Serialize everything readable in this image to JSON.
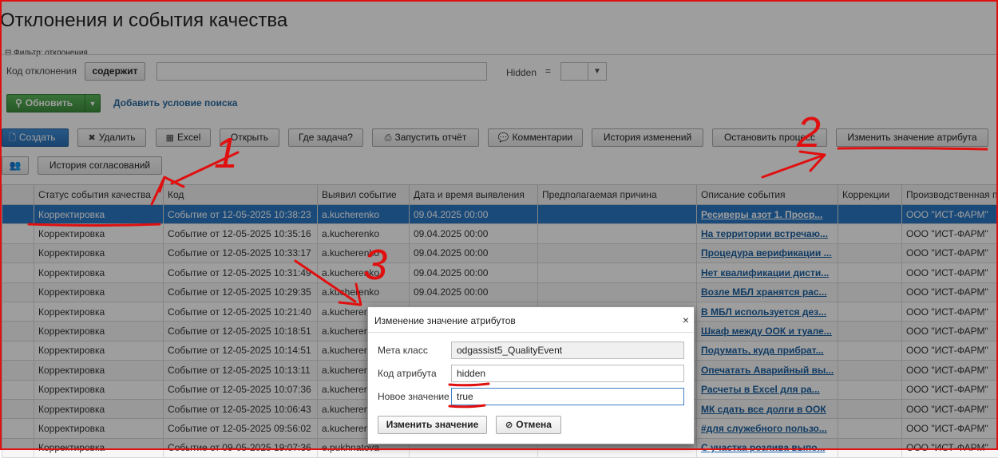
{
  "page": {
    "title": "Отклонения и события качества"
  },
  "filter": {
    "legend": "⊟ Фильтр: отклонения",
    "code_label": "Код отклонения",
    "operator_label": "содержит",
    "code_value": "",
    "hidden_label": "Hidden",
    "eq_sign": "="
  },
  "actions": {
    "refresh_label": "Обновить",
    "add_condition_link": "Добавить условие поиска"
  },
  "toolbar": {
    "create": "Создать",
    "delete": "Удалить",
    "excel": "Excel",
    "open": "Открыть",
    "where_task": "Где задача?",
    "run_report": "Запустить отчёт",
    "comments": "Комментарии",
    "history": "История изменений",
    "stop_process": "Остановить процесс",
    "change_attr": "Изменить значение атрибута",
    "approval_history": "История согласований"
  },
  "table": {
    "headers": [
      "",
      "Статус события качества",
      "Код",
      "Выявил событие",
      "Дата и время выявления",
      "Предполагаемая причина",
      "Описание события",
      "Коррекции",
      "Производственная п"
    ],
    "rows": [
      [
        "",
        "Корректировка",
        "Событие от 12-05-2025 10:38:23",
        "a.kucherenko",
        "09.04.2025 00:00",
        "",
        "Ресиверы азот 1. Проср...",
        "",
        "ООО \"ИСТ-ФАРМ\""
      ],
      [
        "",
        "Корректировка",
        "Событие от 12-05-2025 10:35:16",
        "a.kucherenko",
        "09.04.2025 00:00",
        "",
        "На территории встречаю...",
        "",
        "ООО \"ИСТ-ФАРМ\""
      ],
      [
        "",
        "Корректировка",
        "Событие от 12-05-2025 10:33:17",
        "a.kucherenko",
        "09.04.2025 00:00",
        "",
        "Процедура верификации ...",
        "",
        "ООО \"ИСТ-ФАРМ\""
      ],
      [
        "",
        "Корректировка",
        "Событие от 12-05-2025 10:31:49",
        "a.kucherenko",
        "09.04.2025 00:00",
        "",
        "Нет квалификации дисти...",
        "",
        "ООО \"ИСТ-ФАРМ\""
      ],
      [
        "",
        "Корректировка",
        "Событие от 12-05-2025 10:29:35",
        "a.kucherenko",
        "09.04.2025 00:00",
        "",
        "Возле МБЛ хранятся рас...",
        "",
        "ООО \"ИСТ-ФАРМ\""
      ],
      [
        "",
        "Корректировка",
        "Событие от 12-05-2025 10:21:40",
        "a.kucherenko",
        "",
        "",
        "В МБЛ используется дез...",
        "",
        "ООО \"ИСТ-ФАРМ\""
      ],
      [
        "",
        "Корректировка",
        "Событие от 12-05-2025 10:18:51",
        "a.kucherenko",
        "",
        "",
        "Шкаф между ООК и туале...",
        "",
        "ООО \"ИСТ-ФАРМ\""
      ],
      [
        "",
        "Корректировка",
        "Событие от 12-05-2025 10:14:51",
        "a.kucherenko",
        "",
        "",
        "Подумать, куда прибрат...",
        "",
        "ООО \"ИСТ-ФАРМ\""
      ],
      [
        "",
        "Корректировка",
        "Событие от 12-05-2025 10:13:11",
        "a.kucherenko",
        "",
        "",
        "Опечатать Аварийный вы...",
        "",
        "ООО \"ИСТ-ФАРМ\""
      ],
      [
        "",
        "Корректировка",
        "Событие от 12-05-2025 10:07:36",
        "a.kucherenko",
        "",
        "",
        "Расчеты в Excel для ра...",
        "",
        "ООО \"ИСТ-ФАРМ\""
      ],
      [
        "",
        "Корректировка",
        "Событие от 12-05-2025 10:06:43",
        "a.kucherenko",
        "",
        "",
        "МК сдать все долги в ООК",
        "",
        "ООО \"ИСТ-ФАРМ\""
      ],
      [
        "",
        "Корректировка",
        "Событие от 12-05-2025 09:56:02",
        "a.kucherenko",
        "",
        "",
        "#для служебного пользо...",
        "",
        "ООО \"ИСТ-ФАРМ\""
      ],
      [
        "",
        "Корректировка",
        "Событие от 09-05-2025 19:07:36",
        "e.pukhnatova",
        "",
        "",
        "С участка розлива выпо...",
        "",
        "ООО \"ИСТ-ФАРМ\""
      ]
    ]
  },
  "modal": {
    "title": "Изменение значение атрибутов",
    "close": "×",
    "meta_label": "Мета класс",
    "meta_value": "odgassist5_QualityEvent",
    "code_label": "Код атрибута",
    "code_value": "hidden",
    "new_label": "Новое значение",
    "new_value": "true",
    "submit": "Изменить значение",
    "cancel": "Отмена"
  },
  "annotations": {
    "n1": "1",
    "n2": "2",
    "n3": "3",
    "color": "#e01010"
  }
}
